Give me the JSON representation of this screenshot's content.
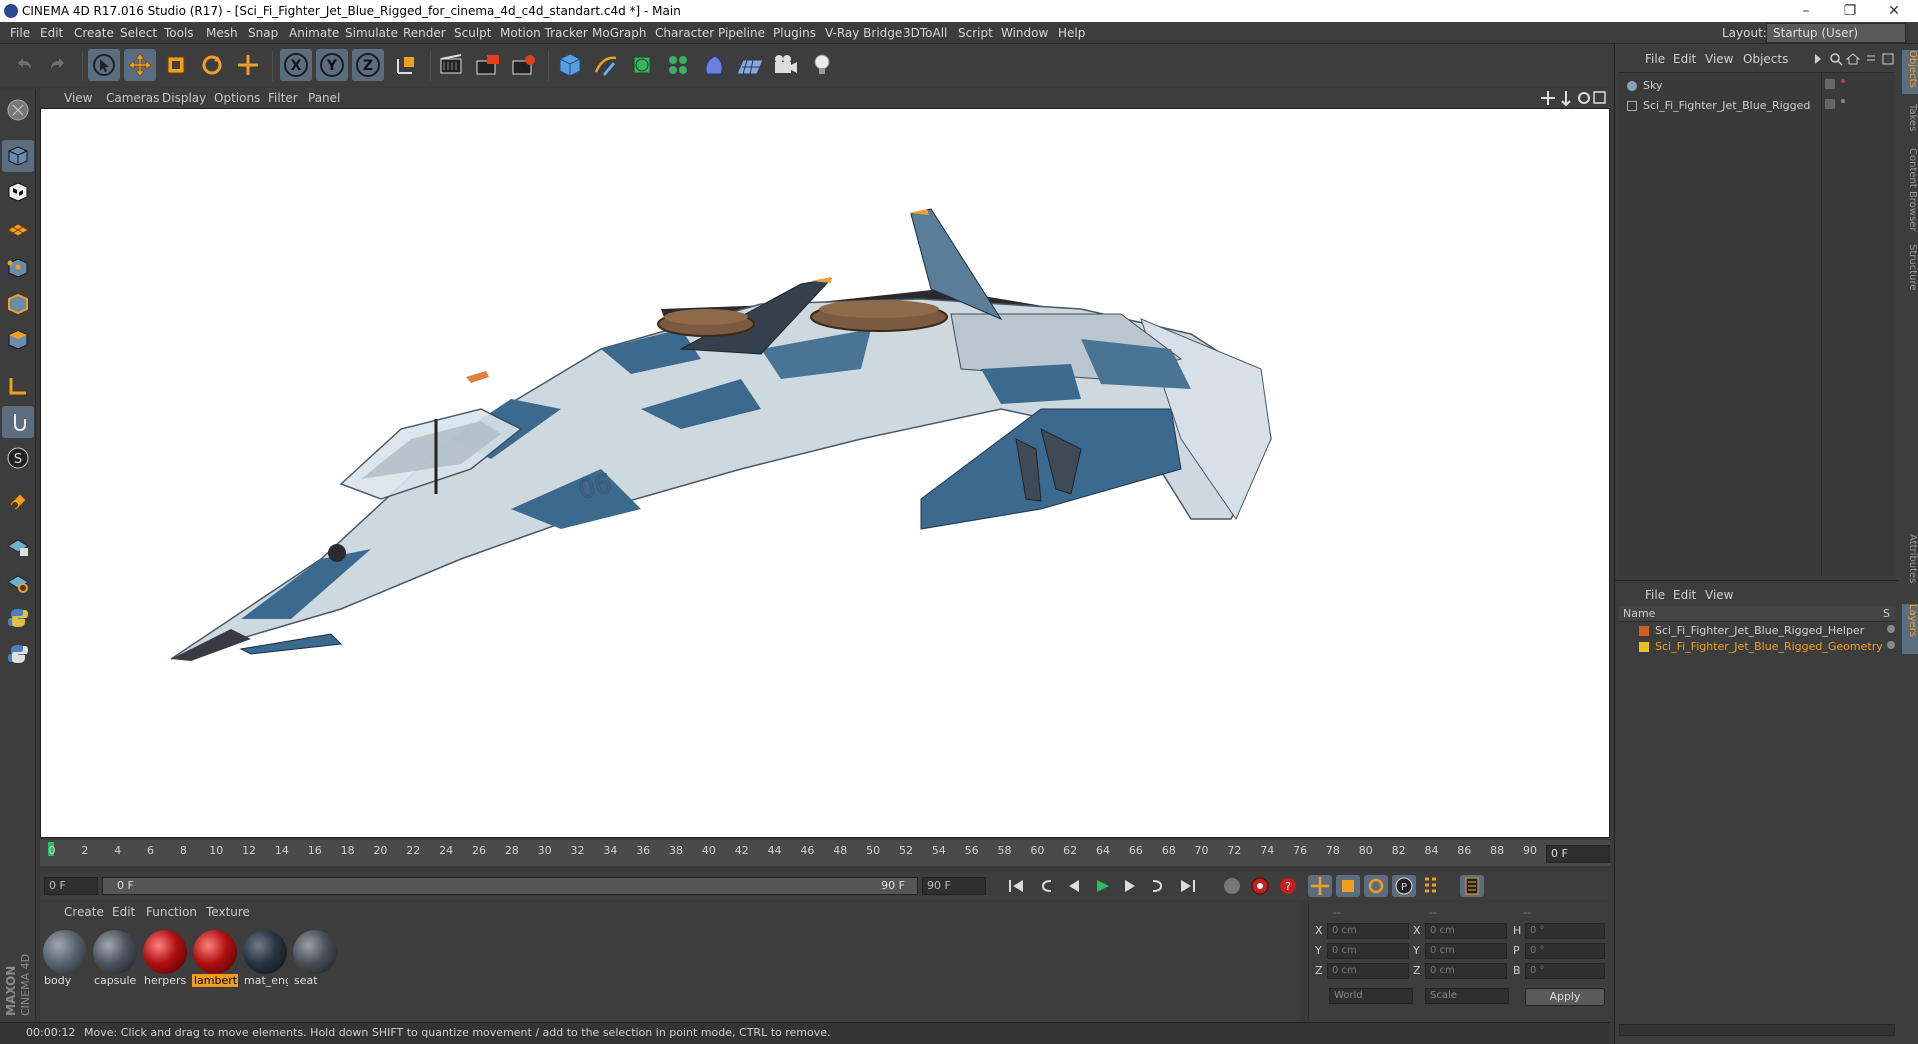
{
  "title_bar": {
    "title": "CINEMA 4D R17.016 Studio (R17) - [Sci_Fi_Fighter_Jet_Blue_Rigged_for_cinema_4d_c4d_standart.c4d *] - Main",
    "minimize": "–",
    "restore": "❐",
    "close": "✕"
  },
  "menu": {
    "items": [
      "File",
      "Edit",
      "Create",
      "Select",
      "Tools",
      "Mesh",
      "Snap",
      "Animate",
      "Simulate",
      "Render",
      "Sculpt",
      "Motion Tracker",
      "MoGraph",
      "Character",
      "Pipeline",
      "Plugins",
      "V-Ray Bridge",
      "3DToAll",
      "Script",
      "Window",
      "Help"
    ],
    "layout_label": "Layout:",
    "layout_value": "Startup (User)"
  },
  "toolbar": {
    "icons": [
      "undo-icon",
      "redo-icon",
      "live-select-icon",
      "move-icon",
      "scale-icon",
      "rotate-icon",
      "last-tool-icon",
      "x-axis-icon",
      "y-axis-icon",
      "z-axis-icon",
      "coordinate-system-icon",
      "render-view-icon",
      "render-picture-viewer-icon",
      "edit-render-settings-icon",
      "cube-icon",
      "pen-icon",
      "subdivision-icon",
      "cloner-icon",
      "deformer-icon",
      "floor-icon",
      "camera-icon",
      "light-icon"
    ],
    "axis_x": "X",
    "axis_y": "Y",
    "axis_z": "Z"
  },
  "viewport": {
    "menu": [
      "View",
      "Cameras",
      "Display",
      "Options",
      "Filter",
      "Panel"
    ],
    "model_marking": "06"
  },
  "timeline": {
    "ticks": [
      "0",
      "2",
      "4",
      "6",
      "8",
      "10",
      "12",
      "14",
      "16",
      "18",
      "20",
      "22",
      "24",
      "26",
      "28",
      "30",
      "32",
      "34",
      "36",
      "38",
      "40",
      "42",
      "44",
      "46",
      "48",
      "50",
      "52",
      "54",
      "56",
      "58",
      "60",
      "62",
      "64",
      "66",
      "68",
      "70",
      "72",
      "74",
      "76",
      "78",
      "80",
      "82",
      "84",
      "86",
      "88",
      "90"
    ],
    "current_frame": "0 F",
    "start": "0 F",
    "range_start": "0 F",
    "range_end": "90 F",
    "end": "90 F"
  },
  "materials": {
    "menu": [
      "Create",
      "Edit",
      "Function",
      "Texture"
    ],
    "items": [
      {
        "label": "body",
        "color": "#5a6470"
      },
      {
        "label": "capsule",
        "color": "#4c5560"
      },
      {
        "label": "herpers",
        "color": "#b01010"
      },
      {
        "label": "lambert",
        "color": "#b01010"
      },
      {
        "label": "mat_eng",
        "color": "#2a3440"
      },
      {
        "label": "seat",
        "color": "#4a5058"
      }
    ],
    "selected": "lambert"
  },
  "coordinates": {
    "header": [
      "--",
      "--",
      "--"
    ],
    "rows": [
      {
        "a": "X",
        "av": "0 cm",
        "b": "X",
        "bv": "0 cm",
        "c": "H",
        "cv": "0 °"
      },
      {
        "a": "Y",
        "av": "0 cm",
        "b": "Y",
        "bv": "0 cm",
        "c": "P",
        "cv": "0 °"
      },
      {
        "a": "Z",
        "av": "0 cm",
        "b": "Z",
        "bv": "0 cm",
        "c": "B",
        "cv": "0 °"
      }
    ],
    "world": "World",
    "scale": "Scale",
    "apply": "Apply"
  },
  "status": {
    "time": "00:00:12",
    "message": "Move: Click and drag to move elements. Hold down SHIFT to quantize movement / add to the selection in point mode, CTRL to remove."
  },
  "objects_panel": {
    "menu": [
      "File",
      "Edit",
      "View",
      "Objects"
    ],
    "items": [
      "Sky",
      "Sci_Fi_Fighter_Jet_Blue_Rigged"
    ]
  },
  "layers_panel": {
    "menu": [
      "File",
      "Edit",
      "View"
    ],
    "column_name": "Name",
    "column_s": "S",
    "items": [
      {
        "label": "Sci_Fi_Fighter_Jet_Blue_Rigged_Helper",
        "color": "#d06020"
      },
      {
        "label": "Sci_Fi_Fighter_Jet_Blue_Rigged_Geometry",
        "color": "#e8c020"
      }
    ]
  },
  "side_tabs": [
    "Objects",
    "Takes",
    "Content Browser",
    "Structure",
    "Attributes",
    "Layers"
  ],
  "brand": {
    "line1": "MAXON",
    "line2": "CINEMA 4D"
  }
}
